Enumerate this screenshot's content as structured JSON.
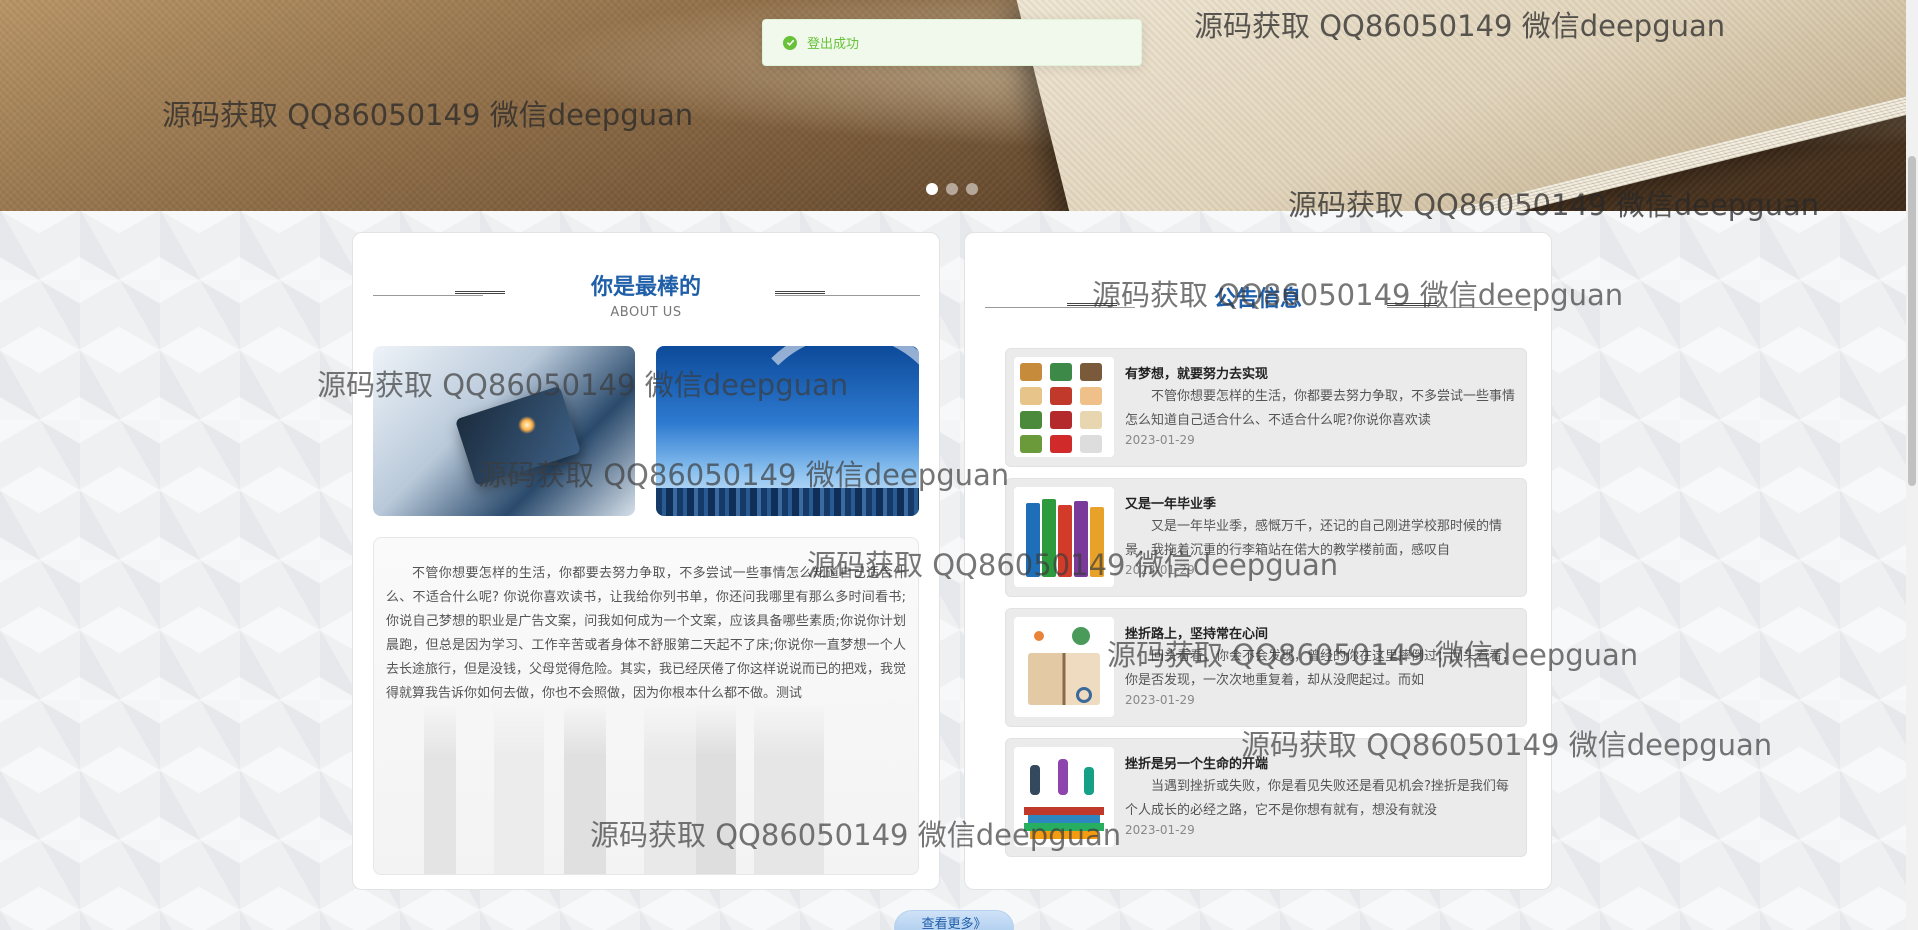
{
  "toast": {
    "message": "登出成功"
  },
  "carousel": {
    "slide_count": 3,
    "active_index": 0
  },
  "about": {
    "title": "你是最棒的",
    "subtitle": "ABOUT US",
    "body": "不管你想要怎样的生活，你都要去努力争取，不多尝试一些事情怎么知道自己适合什么、不适合什么呢? 你说你喜欢读书，让我给你列书单，你还问我哪里有那么多时间看书;你说自己梦想的职业是广告文案，问我如何成为一个文案，应该具备哪些素质;你说你计划晨跑，但总是因为学习、工作辛苦或者身体不舒服第二天起不了床;你说你一直梦想一个人去长途旅行，但是没钱，父母觉得危险。其实，我已经厌倦了你这样说说而已的把戏，我觉得就算我告诉你如何去做，你也不会照做，因为你根本什么都不做。测试"
  },
  "notices": {
    "title": "公告信息",
    "items": [
      {
        "title": "有梦想，就要努力去实现",
        "desc": "不管你想要怎样的生活，你都要去努力争取，不多尝试一些事情怎么知道自己适合什么、不适合什么呢?你说你喜欢读",
        "date": "2023-01-29"
      },
      {
        "title": "又是一年毕业季",
        "desc": "又是一年毕业季，感慨万千，还记的自己刚进学校那时候的情景，我拖着沉重的行李箱站在偌大的教学楼前面，感叹自",
        "date": "2023-01-29"
      },
      {
        "title": "挫折路上，坚持常在心间",
        "desc": "回头看看，你会不会发现，曾经的你在这里摔倒过；回头看看，你是否发现，一次次地重复着，却从没爬起过。而如",
        "date": "2023-01-29"
      },
      {
        "title": "挫折是另一个生命的开端",
        "desc": "当遇到挫折或失败，你是看见失败还是看见机会?挫折是我们每个人成长的必经之路，它不是你想有就有，想没有就没",
        "date": "2023-01-29"
      }
    ]
  },
  "more_button": {
    "label": "查看更多》"
  },
  "watermark": "源码获取 QQ86050149 微信deepguan"
}
